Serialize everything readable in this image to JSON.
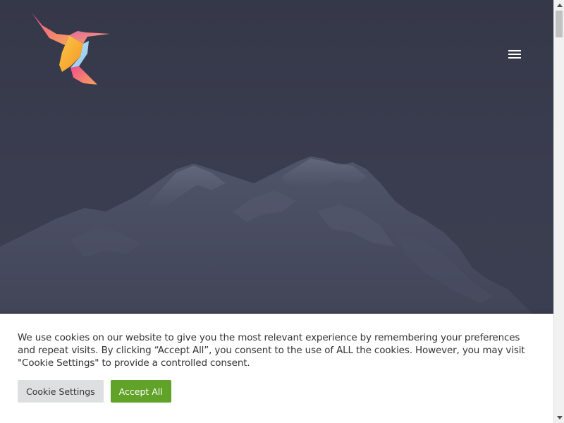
{
  "header": {
    "logo_icon": "hummingbird-logo",
    "menu_icon": "hamburger-menu-icon"
  },
  "hero": {
    "background_color": "#3a3d4e",
    "image": "snowy-mountain-peak"
  },
  "cookie_banner": {
    "message": "We use cookies on our website to give you the most relevant experience by remembering your preferences and repeat visits. By clicking “Accept All”, you consent to the use of ALL the cookies. However, you may visit \"Cookie Settings\" to provide a controlled consent.",
    "settings_label": "Cookie Settings",
    "accept_label": "Accept All",
    "accept_color": "#61a229",
    "settings_color": "#dedfe0"
  },
  "scrollbar": {
    "up_icon": "scroll-up-arrow-icon",
    "down_icon": "scroll-down-arrow-icon"
  }
}
